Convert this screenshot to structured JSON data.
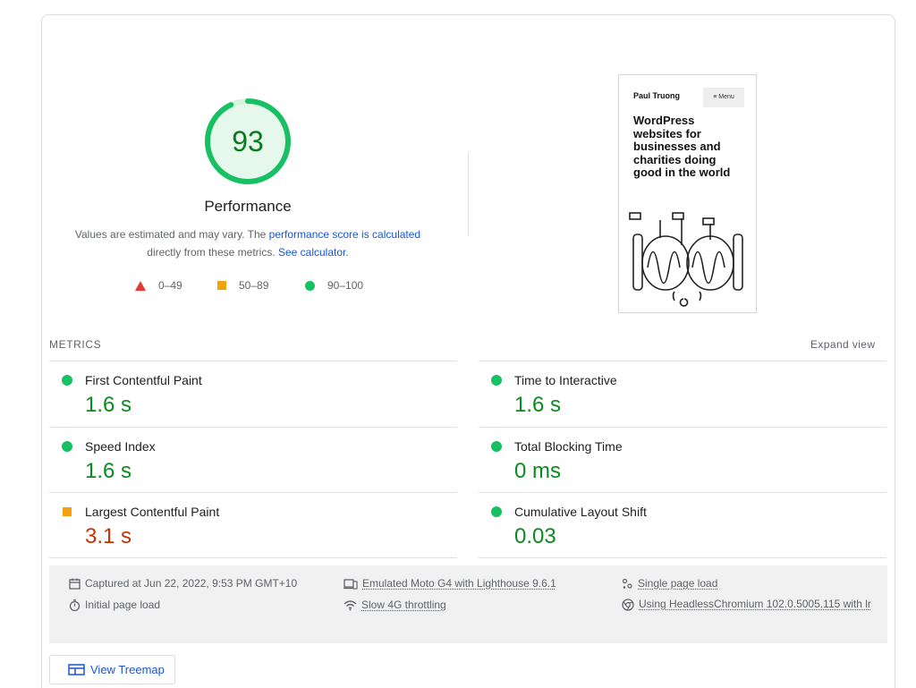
{
  "performance": {
    "score": "93",
    "score_fraction": 0.93,
    "title": "Performance",
    "desc_prefix": "Values are estimated and may vary. The ",
    "desc_link1": "performance score is calculated",
    "desc_middle": " directly from these metrics. ",
    "desc_link2": "See calculator.",
    "colors": {
      "pass": "#18c064",
      "average": "#f2a10f",
      "fail": "#e53935",
      "score_text": "#0a7a22"
    },
    "legend": [
      {
        "icon": "triangle-fail-icon",
        "label": "0–49"
      },
      {
        "icon": "square-average-icon",
        "label": "50–89"
      },
      {
        "icon": "circle-pass-icon",
        "label": "90–100"
      }
    ]
  },
  "screenshot": {
    "site_name": "Paul Truong",
    "menu_label": "≡ Menu",
    "headline": "WordPress websites for businesses and charities doing good in the world"
  },
  "metrics": {
    "heading": "METRICS",
    "expand_label": "Expand view",
    "items": [
      {
        "name": "First Contentful Paint",
        "value": "1.6 s",
        "status": "pass"
      },
      {
        "name": "Time to Interactive",
        "value": "1.6 s",
        "status": "pass"
      },
      {
        "name": "Speed Index",
        "value": "1.6 s",
        "status": "pass"
      },
      {
        "name": "Total Blocking Time",
        "value": "0 ms",
        "status": "pass"
      },
      {
        "name": "Largest Contentful Paint",
        "value": "3.1 s",
        "status": "average"
      },
      {
        "name": "Cumulative Layout Shift",
        "value": "0.03",
        "status": "pass"
      }
    ]
  },
  "runtime": {
    "captured": "Captured at Jun 22, 2022, 9:53 PM GMT+10",
    "initial_load": "Initial page load",
    "device": "Emulated Moto G4 with Lighthouse 9.6.1",
    "throttling": "Slow 4G throttling",
    "single_load": "Single page load",
    "browser": "Using HeadlessChromium 102.0.5005.115 with lr"
  },
  "treemap": {
    "label": "View Treemap"
  }
}
